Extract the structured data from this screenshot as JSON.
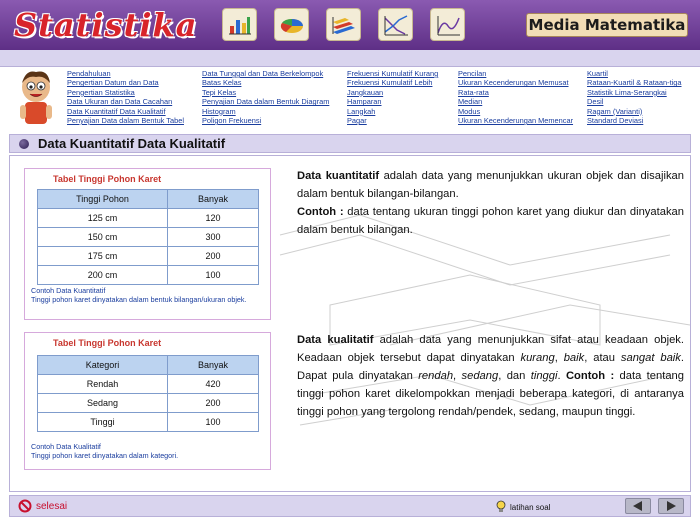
{
  "header": {
    "logo_text": "Statistika",
    "brand": "Media Matematika",
    "icons": [
      "bar-chart-icon",
      "pie-chart-icon",
      "3d-bar-chart-icon",
      "line-chart-icon",
      "scatter-chart-icon"
    ]
  },
  "nav": {
    "col1": [
      "Pendahuluan",
      "Pengertian Datum dan Data",
      "Pengertian Statistika",
      "Data Ukuran dan Data Cacahan",
      "Data Kuantitatif Data Kualitatif",
      "Penyajian Data dalam Bentuk Tabel"
    ],
    "col2": [
      "Data Tunggal dan Data Berkelompok",
      "Batas Kelas",
      "Tepi Kelas",
      "Penyajian Data dalam Bentuk Diagram",
      "Histogram",
      "Poligon Frekuensi"
    ],
    "col3": [
      "Frekuensi Kumulatif Kurang",
      "Frekuensi Kumulatif Lebih",
      "Jangkauan",
      "Hamparan",
      "Langkah",
      "Pagar"
    ],
    "col4": [
      "Pencilan",
      "Ukuran Kecenderungan Memusat",
      "Rata-rata",
      "Median",
      "Modus",
      "Ukuran Kecenderungan Memencar"
    ],
    "col5": [
      "Kuartil",
      "Rataan-Kuartil & Rataan-tiga",
      "Statistik Lima-Serangkai",
      "Desil",
      "Ragam (Varianti)",
      "Standard Deviasi"
    ]
  },
  "title": "Data Kuantitatif Data Kualitatif",
  "table1": {
    "title": "Tabel Tinggi Pohon Karet",
    "headers": [
      "Tinggi Pohon",
      "Banyak"
    ],
    "rows": [
      [
        "125 cm",
        "120"
      ],
      [
        "150 cm",
        "300"
      ],
      [
        "175 cm",
        "200"
      ],
      [
        "200 cm",
        "100"
      ]
    ],
    "note_title": "Contoh Data Kuantitatif",
    "note_body": "Tinggi pohon karet dinyatakan dalam bentuk bilangan/ukuran objek."
  },
  "table2": {
    "title": "Tabel Tinggi Pohon Karet",
    "headers": [
      "Kategori",
      "Banyak"
    ],
    "rows": [
      [
        "Rendah",
        "420"
      ],
      [
        "Sedang",
        "200"
      ],
      [
        "Tinggi",
        "100"
      ]
    ],
    "note_title": "Contoh Data Kualitatif",
    "note_body": "Tinggi pohon karet dinyatakan dalam kategori."
  },
  "para1": {
    "term": "Data kuantitatif",
    "def": " adalah data yang menunjukkan ukuran objek dan disajikan dalam bentuk bilangan-bilangan.",
    "ex_label": "Contoh :",
    "ex": " data tentang ukuran tinggi pohon karet yang diukur dan dinyatakan dalam bentuk bilangan."
  },
  "para2": {
    "term": "Data kualitatif",
    "def_a": " adalah data yang menunjukkan sifat atau keadaan objek. Keadaan objek tersebut dapat dinyatakan ",
    "i1": "kurang",
    "s1": ", ",
    "i2": "baik",
    "s2": ", atau ",
    "i3": "sangat baik",
    "s3": ". Dapat pula dinyatakan ",
    "i4": "rendah",
    "s4": ", ",
    "i5": "sedang",
    "s5": ", dan ",
    "i6": "tinggi",
    "s6": ".",
    "ex_label": "Contoh :",
    "ex": " data tentang tinggi pohon karet dikelompokkan menjadi beberapa kategori, di antaranya tinggi pohon yang tergolong rendah/pendek, sedang, maupun tinggi."
  },
  "footer": {
    "exit_label": "selesai",
    "exercise_label": "latihan soal"
  },
  "colors": {
    "header": "#6b3f8e",
    "lavender": "#d9d4ee",
    "brand_bg": "#f2ddb6",
    "link": "#1a3d9e",
    "panel_title": "#c8372f",
    "table_header": "#bcd3f0"
  }
}
